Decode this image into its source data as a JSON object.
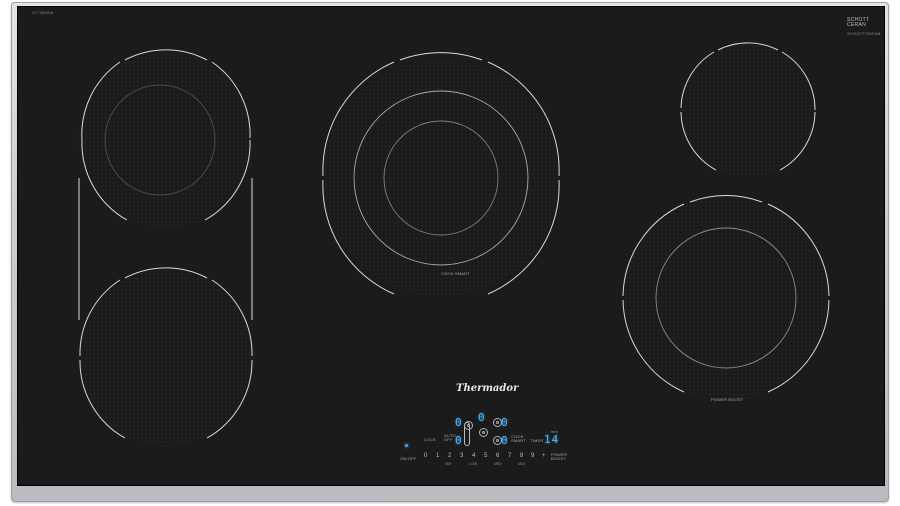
{
  "model_label": "CIT36XKB",
  "schott_brand": [
    "SCHOTT",
    "CERAN"
  ],
  "schott_sub": "SCHOTTCERAN",
  "brand_logo": "Thermador",
  "zones": {
    "center_label": "COOK SMART",
    "right_bottom_label": "POWER BOOST"
  },
  "controls": {
    "onoff_label": "ON/OFF",
    "lock_label": "LOCK",
    "auto_label": [
      "AUTO",
      "OFF"
    ],
    "cook_smart_label": [
      "COOK",
      "SMART"
    ],
    "timer_label": "TIMER",
    "timer_unit": "min",
    "timer_value": "14",
    "power_boost_label": [
      "POWER",
      "BOOST"
    ],
    "zone_digits": [
      "0",
      "0",
      "0",
      "0",
      "0"
    ],
    "slider_numbers": [
      "0",
      "1",
      "2",
      "3",
      "4",
      "5",
      "6",
      "7",
      "8",
      "9"
    ],
    "slider_plus": "+",
    "slider_sub_labels": [
      "SIM",
      "LOW",
      "MED",
      "MAX"
    ]
  },
  "colors": {
    "glass": "#1b1b1b",
    "frame": "#cdd0d3",
    "display": "#47b6ff",
    "ring": "#d9d9d9"
  }
}
